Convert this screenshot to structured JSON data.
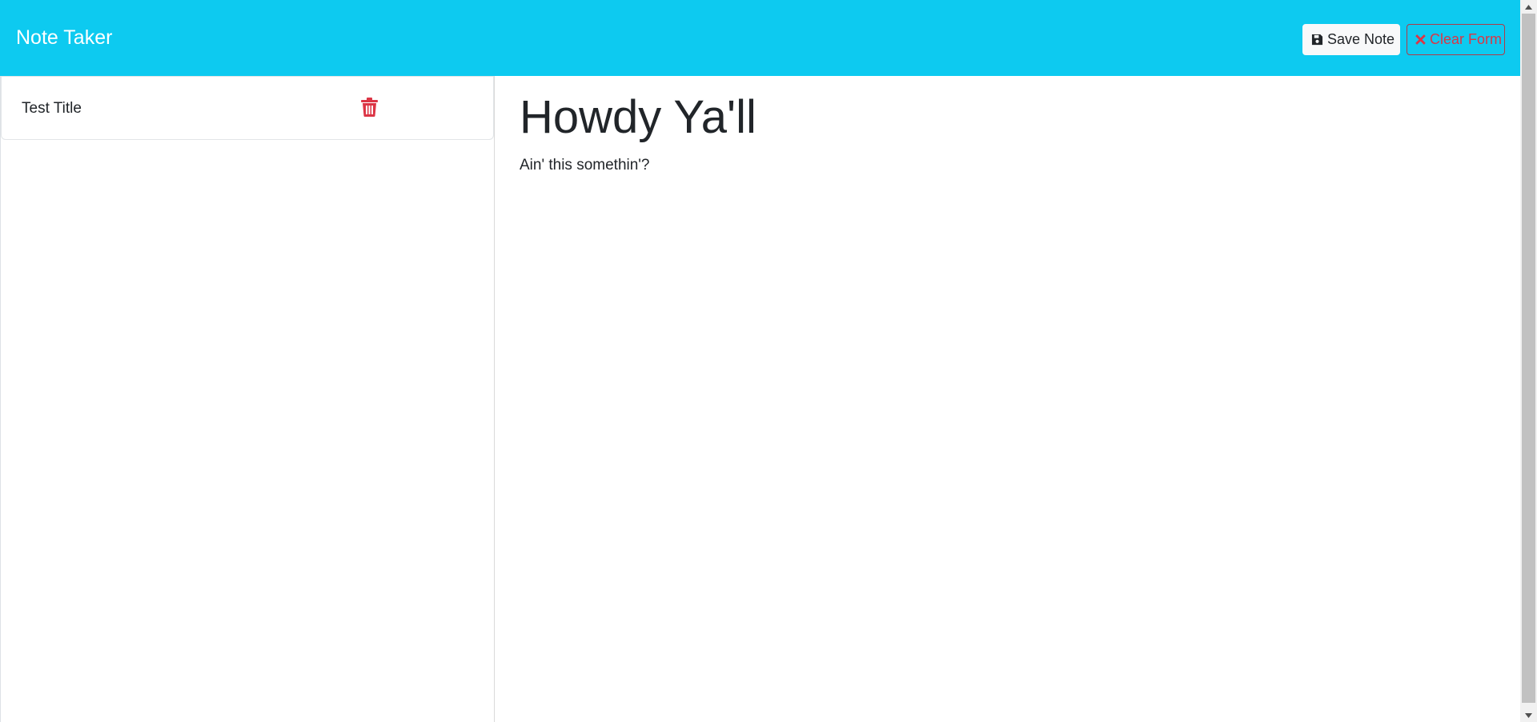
{
  "app": {
    "brand": "Note Taker"
  },
  "toolbar": {
    "save_label": "Save Note",
    "clear_label": "Clear Form",
    "save_icon": "floppy-disk-icon",
    "clear_icon": "x-icon"
  },
  "sidebar": {
    "items": [
      {
        "title": "Test Title",
        "icon": "trash-icon"
      }
    ]
  },
  "editor": {
    "title_value": "Howdy Ya'll",
    "body_value": "Ain' this somethin'?"
  },
  "colors": {
    "navbar": "#0dcaf0",
    "danger": "#dc3545",
    "light_button": "#f8f9fa"
  }
}
